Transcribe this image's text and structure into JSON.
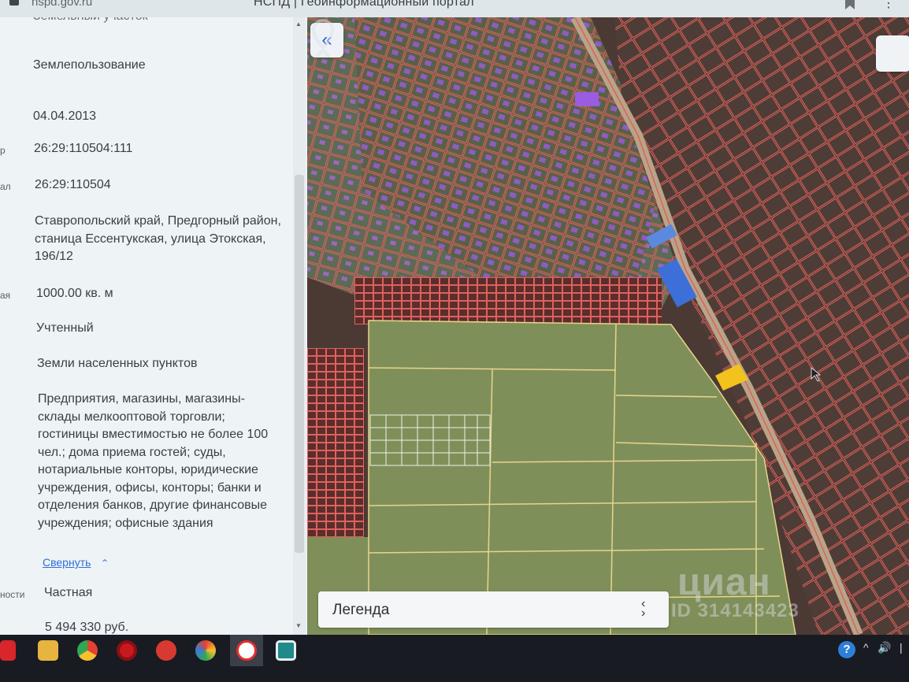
{
  "browser": {
    "url": "nspd.gov.ru",
    "title": "НСПД | Геоинформационный портал"
  },
  "panel": {
    "top_cut_text": "Земельный участок",
    "rows": [
      {
        "value": "Землепользование"
      },
      {
        "value": "04.04.2013"
      },
      {
        "side": "р",
        "value": "26:29:110504:111"
      },
      {
        "side": "ал",
        "value": "26:29:110504"
      },
      {
        "value": "Ставропольский край, Предгорный район, станица Ессентукская, улица Этокская, 196/12"
      },
      {
        "side": "ая",
        "value": "1000.00 кв. м"
      },
      {
        "value": "Учтенный"
      },
      {
        "value": "Земли населенных пунктов"
      },
      {
        "value": "Предприятия, магазины, магазины-склады мелкооптовой торговли; гостиницы вместимостью не более 100 чел.; дома приема гостей; суды, нотариальные конторы, юридические учреждения, офисы, конторы; банки и отделения банков, другие финансовые учреждения; офисные здания"
      },
      {
        "side": "ности",
        "value": "Частная"
      },
      {
        "value": "5 494 330 руб."
      }
    ],
    "collapse_label": "Свернуть"
  },
  "map": {
    "back_icon": "«",
    "legend_label": "Легенда",
    "watermark": "циан",
    "watermark_id": "ID 314143423",
    "colors": {
      "parcel_line": "#e0615c",
      "field": "#7f8f5a",
      "field_line": "#e8d58a",
      "building": "#9a5ce0",
      "highlight": "#f2c21d"
    }
  },
  "taskbar": {
    "apps": [
      "yandex-icon",
      "file-explorer-icon",
      "chrome-icon",
      "opera-icon",
      "wps-icon",
      "photos-icon",
      "yandex-browser-icon",
      "app-icon"
    ],
    "tray": {
      "help": "?",
      "up_arrow": "^",
      "speaker": "🔊",
      "extra": "|"
    }
  }
}
